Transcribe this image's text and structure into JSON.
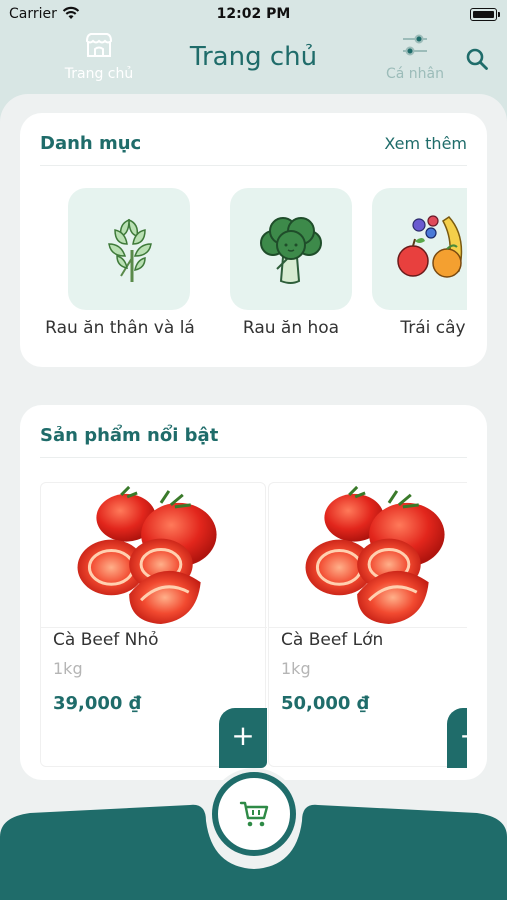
{
  "status_bar": {
    "carrier": "Carrier",
    "time": "12:02 PM"
  },
  "header": {
    "title": "Trang chủ"
  },
  "categories": {
    "title": "Danh mục",
    "see_more": "Xem thêm",
    "items": [
      {
        "label": "Rau ăn thân và lá",
        "icon": "leafy-greens-icon"
      },
      {
        "label": "Rau ăn hoa",
        "icon": "broccoli-icon"
      },
      {
        "label": "Trái cây",
        "icon": "fruits-icon"
      }
    ]
  },
  "featured": {
    "title": "Sản phẩm nổi bật",
    "products": [
      {
        "name": "Cà Beef Nhỏ",
        "unit": "1kg",
        "price": "39,000 ₫",
        "image": "tomato-image"
      },
      {
        "name": "Cà Beef Lớn",
        "unit": "1kg",
        "price": "50,000 ₫",
        "image": "tomato-image"
      }
    ],
    "add_label": "+"
  },
  "bottom_nav": {
    "home": "Trang chủ",
    "profile": "Cá nhân"
  },
  "colors": {
    "primary": "#1f6c6a",
    "background": "#d8e6e4",
    "tile": "#e6f3ef"
  }
}
